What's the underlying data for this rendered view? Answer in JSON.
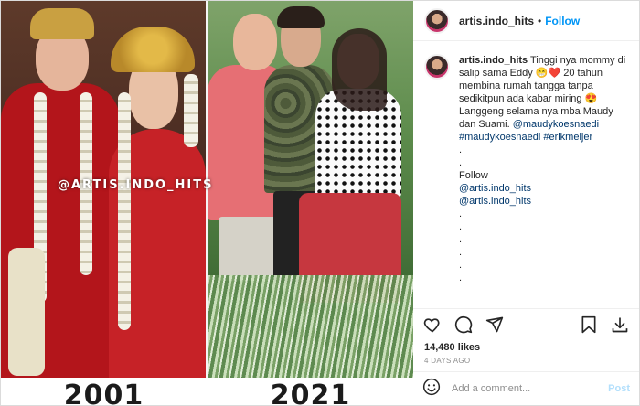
{
  "header": {
    "username": "artis.indo_hits",
    "separator": "•",
    "follow_label": "Follow"
  },
  "media": {
    "watermark": "@ARTIS.INDO_HITS",
    "year_left": "2001",
    "year_right": "2021"
  },
  "caption": {
    "username": "artis.indo_hits",
    "line1": "Tinggi nya mommy di salip sama Eddy 😁❤️ 20 tahun membina rumah tangga tanpa sedikitpun ada kabar miring 😍 Langgeng selama nya mba Maudy dan Suami. ",
    "mention1": "@maudykoesnaedi",
    "hashtags": "#maudykoesnaedi #erikmeijer",
    "dot1": ".",
    "dot2": ".",
    "follow_word": "Follow",
    "mention2": "@artis.indo_hits",
    "mention3": "@artis.indo_hits",
    "dot3": ".",
    "dot4": ".",
    "dot5": ".",
    "dot6": ".",
    "dot7": ".",
    "dot8": "."
  },
  "stats": {
    "likes": "14,480 likes",
    "date": "4 DAYS AGO"
  },
  "comment": {
    "placeholder": "Add a comment...",
    "post_label": "Post"
  },
  "icons": {
    "like": "heart-icon",
    "comment": "comment-icon",
    "share": "share-icon",
    "save": "bookmark-icon",
    "download": "download-icon",
    "emoji": "smiley-icon"
  }
}
